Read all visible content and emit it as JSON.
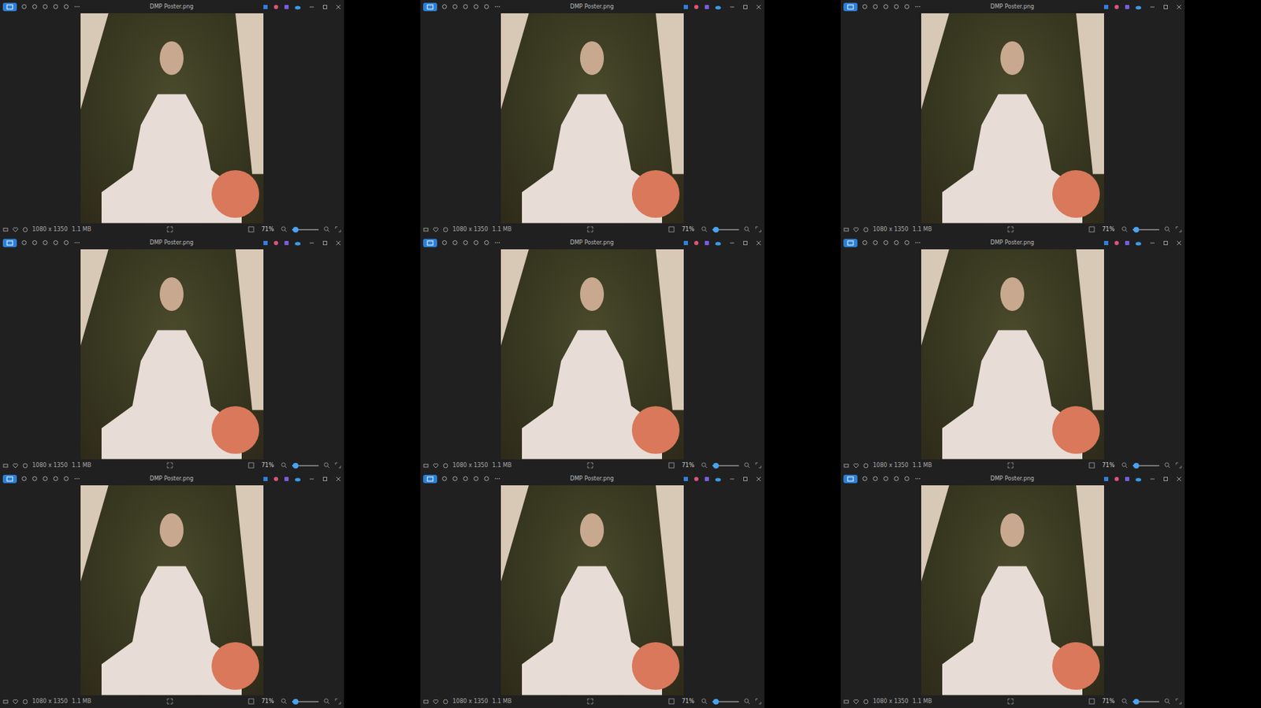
{
  "windows": [
    {
      "title": "DMP Poster.png",
      "dimensions": "1080 x 1350",
      "file_size": "1.1 MB",
      "zoom": "71%",
      "zoom_level": 0.12
    },
    {
      "title": "DMP Poster.png",
      "dimensions": "1080 x 1350",
      "file_size": "1.1 MB",
      "zoom": "71%",
      "zoom_level": 0.12
    },
    {
      "title": "DMP Poster.png",
      "dimensions": "1080 x 1350",
      "file_size": "1.1 MB",
      "zoom": "71%",
      "zoom_level": 0.12
    },
    {
      "title": "DMP Poster.png",
      "dimensions": "1080 x 1350",
      "file_size": "1.1 MB",
      "zoom": "71%",
      "zoom_level": 0.12
    },
    {
      "title": "DMP Poster.png",
      "dimensions": "1080 x 1350",
      "file_size": "1.1 MB",
      "zoom": "71%",
      "zoom_level": 0.12
    },
    {
      "title": "DMP Poster.png",
      "dimensions": "1080 x 1350",
      "file_size": "1.1 MB",
      "zoom": "71%",
      "zoom_level": 0.12
    },
    {
      "title": "DMP Poster.png",
      "dimensions": "1080 x 1350",
      "file_size": "1.1 MB",
      "zoom": "71%",
      "zoom_level": 0.12
    },
    {
      "title": "DMP Poster.png",
      "dimensions": "1080 x 1350",
      "file_size": "1.1 MB",
      "zoom": "71%",
      "zoom_level": 0.12
    },
    {
      "title": "DMP Poster.png",
      "dimensions": "1080 x 1350",
      "file_size": "1.1 MB",
      "zoom": "71%",
      "zoom_level": 0.12
    }
  ]
}
